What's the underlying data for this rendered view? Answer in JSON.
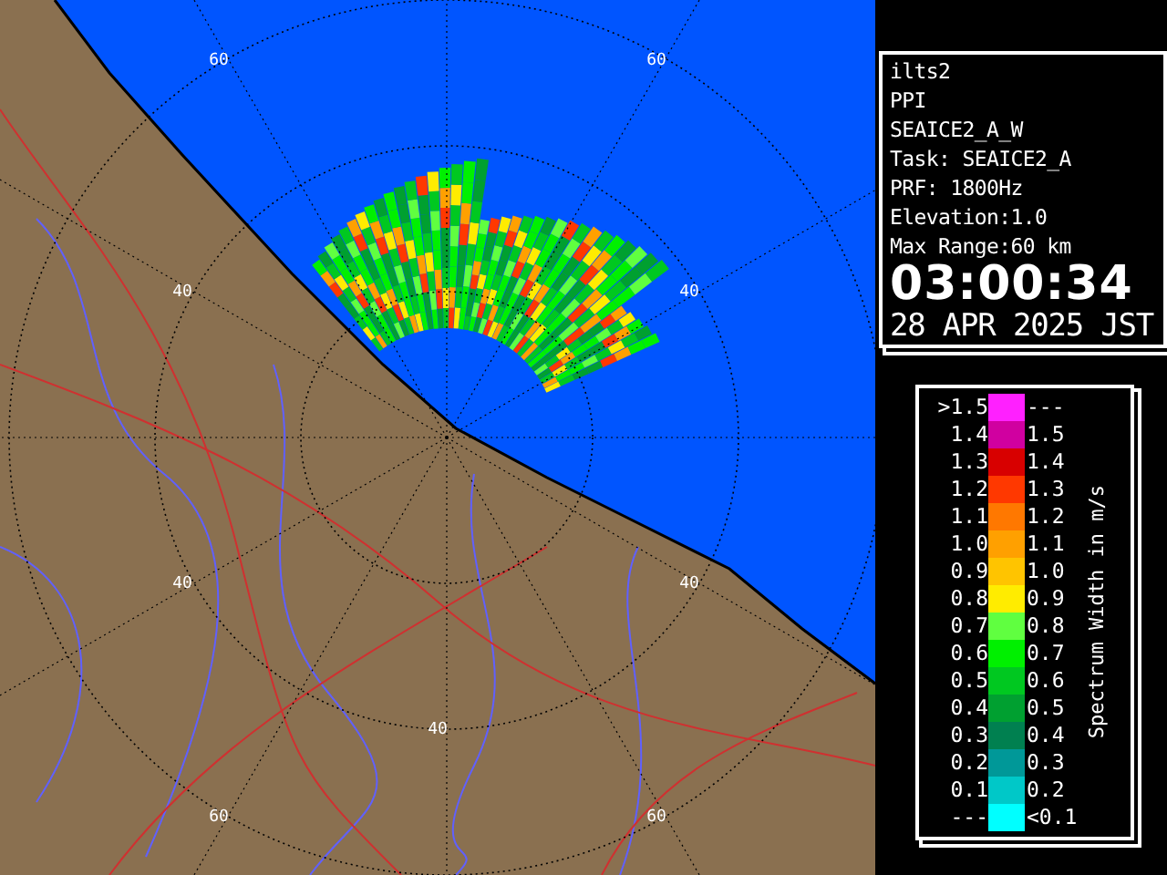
{
  "map": {
    "range_labels": [
      "60",
      "60",
      "40",
      "40",
      "40",
      "40",
      "40",
      "60",
      "60"
    ]
  },
  "info": {
    "lines": [
      "ilts2",
      "PPI",
      "SEAICE2_A_W",
      "Task: SEAICE2_A",
      "PRF: 1800Hz",
      "Elevation:1.0",
      "Max Range:60 km"
    ],
    "time": "03:00:34",
    "date": "28 APR 2025 JST"
  },
  "legend": {
    "title": "Spectrum Width in m/s",
    "rows": [
      {
        "low": ">1.5",
        "high": "---",
        "color": "#ff20ff"
      },
      {
        "low": "1.4",
        "high": "1.5",
        "color": "#d000a0"
      },
      {
        "low": "1.3",
        "high": "1.4",
        "color": "#d80000"
      },
      {
        "low": "1.2",
        "high": "1.3",
        "color": "#ff3800"
      },
      {
        "low": "1.1",
        "high": "1.2",
        "color": "#ff7800"
      },
      {
        "low": "1.0",
        "high": "1.1",
        "color": "#ffa000"
      },
      {
        "low": "0.9",
        "high": "1.0",
        "color": "#ffc400"
      },
      {
        "low": "0.8",
        "high": "0.9",
        "color": "#ffec00"
      },
      {
        "low": "0.7",
        "high": "0.8",
        "color": "#60ff40"
      },
      {
        "low": "0.6",
        "high": "0.7",
        "color": "#00f000"
      },
      {
        "low": "0.5",
        "high": "0.6",
        "color": "#00c820"
      },
      {
        "low": "0.4",
        "high": "0.5",
        "color": "#00a030"
      },
      {
        "low": "0.3",
        "high": "0.4",
        "color": "#008050"
      },
      {
        "low": "0.2",
        "high": "0.3",
        "color": "#009898"
      },
      {
        "low": "0.1",
        "high": "0.2",
        "color": "#00c8c8"
      },
      {
        "low": "---",
        "high": "<0.1",
        "color": "#00ffff"
      }
    ]
  }
}
